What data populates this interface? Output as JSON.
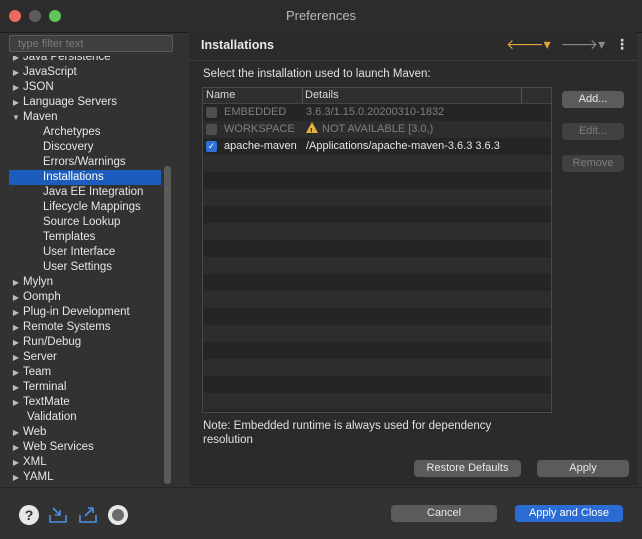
{
  "window": {
    "title": "Preferences"
  },
  "filter": {
    "placeholder": "type filter text"
  },
  "tree": [
    {
      "label": "Java Persistence",
      "level": 0,
      "arrow": "right"
    },
    {
      "label": "JavaScript",
      "level": 0,
      "arrow": "right"
    },
    {
      "label": "JSON",
      "level": 0,
      "arrow": "right"
    },
    {
      "label": "Language Servers",
      "level": 0,
      "arrow": "right"
    },
    {
      "label": "Maven",
      "level": 0,
      "arrow": "down"
    },
    {
      "label": "Archetypes",
      "level": 1
    },
    {
      "label": "Discovery",
      "level": 1
    },
    {
      "label": "Errors/Warnings",
      "level": 1
    },
    {
      "label": "Installations",
      "level": 1,
      "selected": true
    },
    {
      "label": "Java EE Integration",
      "level": 1
    },
    {
      "label": "Lifecycle Mappings",
      "level": 1
    },
    {
      "label": "Source Lookup",
      "level": 1
    },
    {
      "label": "Templates",
      "level": 1
    },
    {
      "label": "User Interface",
      "level": 1
    },
    {
      "label": "User Settings",
      "level": 1
    },
    {
      "label": "Mylyn",
      "level": 0,
      "arrow": "right"
    },
    {
      "label": "Oomph",
      "level": 0,
      "arrow": "right"
    },
    {
      "label": "Plug-in Development",
      "level": 0,
      "arrow": "right"
    },
    {
      "label": "Remote Systems",
      "level": 0,
      "arrow": "right"
    },
    {
      "label": "Run/Debug",
      "level": 0,
      "arrow": "right"
    },
    {
      "label": "Server",
      "level": 0,
      "arrow": "right"
    },
    {
      "label": "Team",
      "level": 0,
      "arrow": "right"
    },
    {
      "label": "Terminal",
      "level": 0,
      "arrow": "right"
    },
    {
      "label": "TextMate",
      "level": 0,
      "arrow": "right"
    },
    {
      "label": "Validation",
      "level": 0,
      "arrow": "none"
    },
    {
      "label": "Web",
      "level": 0,
      "arrow": "right"
    },
    {
      "label": "Web Services",
      "level": 0,
      "arrow": "right"
    },
    {
      "label": "XML",
      "level": 0,
      "arrow": "right"
    },
    {
      "label": "YAML",
      "level": 0,
      "arrow": "right"
    }
  ],
  "page": {
    "title": "Installations",
    "description": "Select the installation used to launch Maven:",
    "note": "Note: Embedded runtime is always used for dependency resolution"
  },
  "table": {
    "columns": [
      "Name",
      "Details"
    ],
    "rows": [
      {
        "checked": false,
        "name": "EMBEDDED",
        "details": "3.6.3/1.15.0.20200310-1832",
        "enabled": false,
        "warning": false
      },
      {
        "checked": false,
        "name": "WORKSPACE",
        "details": "NOT AVAILABLE [3.0,)",
        "enabled": false,
        "warning": true
      },
      {
        "checked": true,
        "name": "apache-maven",
        "details": "/Applications/apache-maven-3.6.3 3.6.3",
        "enabled": true,
        "warning": false
      }
    ]
  },
  "buttons": {
    "add": "Add...",
    "edit": "Edit...",
    "remove": "Remove",
    "restore_defaults": "Restore Defaults",
    "apply": "Apply",
    "cancel": "Cancel",
    "apply_close": "Apply and Close"
  },
  "icons": {
    "back": "arrow-left-icon",
    "forward": "arrow-right-icon",
    "menu": "view-menu-icon",
    "help": "help-icon",
    "import": "import-icon",
    "export": "export-icon",
    "record": "record-icon"
  },
  "colors": {
    "selection": "#1c5cbd",
    "primary_button": "#2a6cd4",
    "warning": "#e3b341"
  }
}
